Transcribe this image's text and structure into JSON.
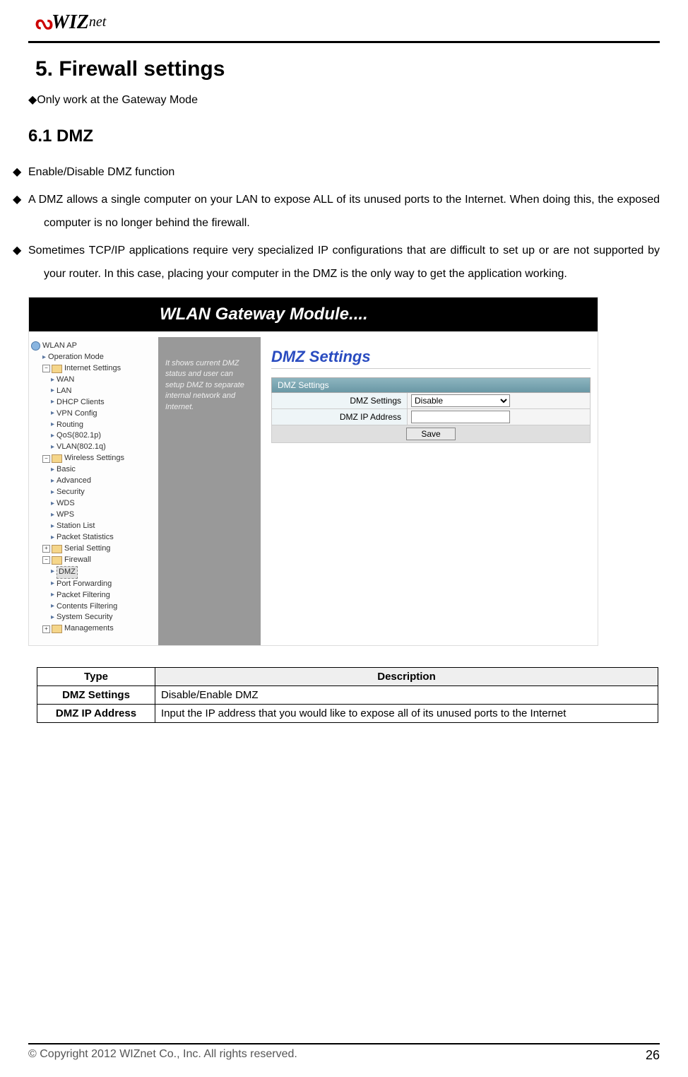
{
  "logo": {
    "brand": "WIZ",
    "brand2": "net"
  },
  "heading1": "5. Firewall settings",
  "note1": "Only work at the Gateway Mode",
  "heading2": "6.1  DMZ",
  "bullets": {
    "b1": "Enable/Disable DMZ function",
    "b2": "A DMZ allows a single computer on your LAN to expose ALL of its unused ports to the Internet. When doing this, the exposed computer is no longer behind the firewall.",
    "b3": "Sometimes TCP/IP applications require very specialized IP configurations that are difficult to set up or are not supported by your router. In this case, placing your computer in the DMZ is the only way to get the application working."
  },
  "screenshot": {
    "banner": "WLAN Gateway Module....",
    "tree": {
      "root": "WLAN AP",
      "op_mode": "Operation Mode",
      "internet": "Internet Settings",
      "wan": "WAN",
      "lan": "LAN",
      "dhcp": "DHCP Clients",
      "vpn": "VPN Config",
      "routing": "Routing",
      "qos": "QoS(802.1p)",
      "vlan": "VLAN(802.1q)",
      "wireless": "Wireless Settings",
      "basic": "Basic",
      "advanced": "Advanced",
      "security": "Security",
      "wds": "WDS",
      "wps": "WPS",
      "station": "Station List",
      "packet_stat": "Packet Statistics",
      "serial": "Serial Setting",
      "firewall": "Firewall",
      "dmz": "DMZ",
      "port_fwd": "Port Forwarding",
      "packet_filt": "Packet Filtering",
      "content_filt": "Contents Filtering",
      "sys_sec": "System Security",
      "mgmt": "Managements"
    },
    "sidebar_text": "It shows current DMZ status and user can setup DMZ to separate internal network and Internet.",
    "main_title": "DMZ Settings",
    "panel": {
      "header": "DMZ Settings",
      "row1_label": "DMZ Settings",
      "row1_value": "Disable",
      "row2_label": "DMZ IP Address",
      "row2_value": "",
      "save": "Save"
    }
  },
  "table": {
    "h_type": "Type",
    "h_desc": "Description",
    "r1_type": "DMZ Settings",
    "r1_desc": "Disable/Enable DMZ",
    "r2_type": "DMZ IP Address",
    "r2_desc": "Input the IP address that you would like to expose all of its unused ports to the Internet"
  },
  "footer": {
    "copyright": "© Copyright 2012 WIZnet Co., Inc. All rights reserved.",
    "page": "26"
  }
}
